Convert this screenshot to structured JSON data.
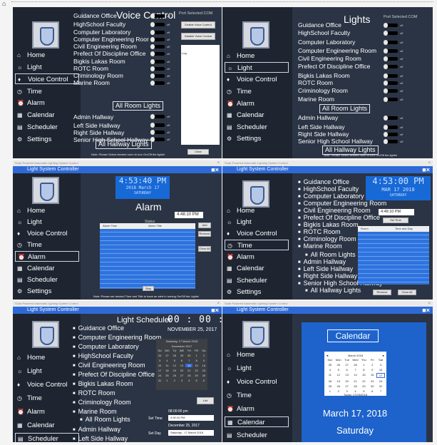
{
  "nav": {
    "home": "Home",
    "light": "Light",
    "voice": "Voice Control",
    "time": "Time",
    "alarm": "Alarm",
    "calendar": "Calendar",
    "scheduler": "Scheduler",
    "settings": "Settings"
  },
  "icons": [
    "home-icon",
    "bulb-icon",
    "mic-icon",
    "clock-icon",
    "alarm-icon",
    "calendar-icon",
    "scheduler-icon",
    "settings-icon"
  ],
  "accent": "#2e6ad6",
  "window_title": "Light System Controller",
  "outer_title": "Solar Powered Automatic Lighting System Control",
  "off": "off",
  "voice": {
    "title": "Voice Control",
    "port": "Port Selected COM",
    "enable": "Enable Voice Control",
    "disable": "Disable Voice Control",
    "log": "Log",
    "clear": "Clear",
    "rooms": [
      "Guidance Office",
      "HighSchool Faculty",
      "Computer Laboratory",
      "Computer Engineering Roor",
      "Civil Engineering Room",
      "Prefect Of Discipline Office",
      "Bigkis Lakas Room",
      "ROTC Room",
      "Criminology Room",
      "Marine Room"
    ],
    "all_rooms": "All Room Lights",
    "halls": [
      "Admin Hallway",
      "Left Side Hallway",
      "Right Side Hallway",
      "Senior High School Hallway"
    ],
    "all_halls": "All Hallway Lights",
    "note": "Note: Please Select desired room to turn On/Off the lights!"
  },
  "lights": {
    "title": "Lights",
    "port": "Port Selected COM",
    "rooms": [
      "Guidance Office",
      "HighSchool Faculty",
      "Computer Laboratory",
      "Computer Engineering Room",
      "Civil Engineering Room",
      "Prefect Of Discipline Office",
      "Bigkis Lakas Room",
      "ROTC Room",
      "Criminology Room",
      "Marine Room"
    ],
    "all_rooms": "All Room Lights",
    "halls": [
      "Admin Hallway",
      "Left Side Hallway",
      "Right Side Hallway",
      "Senior High School Hallway"
    ],
    "all_halls": "All Hallway Lights",
    "note": "Note: Please Select desired room to turn On/Off the lights!"
  },
  "alarm": {
    "clock": "4:53:40 PM",
    "date": "2018 March 17",
    "day": "SATURDAY",
    "title": "Alarm",
    "time_value": "4:48:10 PM",
    "status": "Status",
    "col1": "Alarm Time",
    "col2": "Alarm Title",
    "add": "Add",
    "remove": "Remove",
    "clear_all": "Clear All",
    "stop": "Stop",
    "note": "Note: Please set desired Time and Title to have an alert in turning On/Off the Lights!"
  },
  "time_panel": {
    "clock": "4:53:00 PM",
    "date": "MAR 17 2018",
    "day": "SATURDAY",
    "time_value": "4:48:10 PM",
    "set_time": "Set Time",
    "col1": "Room",
    "col2": "Time and Day",
    "remove": "Remove",
    "clear_all": "Clear All",
    "rooms": [
      "Guidance Office",
      "HighSchool Faculty",
      "Computer Laboratory",
      "Computer Engineering Room",
      "Civil Engineering Room",
      "Prefect Of Discipline Office",
      "Bigkis Lakas Room",
      "ROTC Room",
      "Criminology Room",
      "Marine Room"
    ],
    "all_rooms": "All Room Lights",
    "halls": [
      "Admin Hallway",
      "Left Side Hallway",
      "Right Side Hallway",
      "Senior High School Hallway"
    ],
    "all_halls": "All Hallway Lights"
  },
  "scheduler": {
    "title": "Light Scheduler",
    "clock": "00 : 00 : 00",
    "date": "NOVEMBER 25, 2017",
    "rooms": [
      "Guidance Office",
      "Computer Engineering Room",
      "Computer Laboratory",
      "HighSchool Faculty",
      "Civil Engineering Room",
      "Prefect Of Discipline Office",
      "Bigkis Lakas Room",
      "ROTC Room",
      "Criminology Room",
      "Marine Room"
    ],
    "all_rooms": "All Room Lights",
    "halls": [
      "Admin Hallway",
      "Left Side Hallway"
    ],
    "cal_header": "Saturday, 17 March 2018",
    "cal_month": "December 2017",
    "cal_days": [
      "SU",
      "MO",
      "TU",
      "WE",
      "TH",
      "FR",
      "SA"
    ],
    "cal_dates": [
      "26",
      "27",
      "28",
      "29",
      "30",
      "1",
      "2",
      "3",
      "4",
      "5",
      "6",
      "7",
      "8",
      "9",
      "10",
      "11",
      "12",
      "13",
      "14",
      "15",
      "16",
      "17",
      "18",
      "19",
      "20",
      "21",
      "22",
      "23",
      "24",
      "25",
      "26",
      "27",
      "28",
      "29",
      "30",
      "31",
      "1",
      "2",
      "3",
      "4",
      "5",
      "6"
    ],
    "selected": "14",
    "list": "List",
    "time_shown": "08:00:00 pm",
    "set_time": "Set Time",
    "set_time_value": "4:30:10 PM",
    "date_shown": "December 25, 2017",
    "set_day": "Set Day",
    "set_day_value": "Saturday , 17   March   2018"
  },
  "calendar": {
    "title": "Calendar",
    "month": "March 2018",
    "days": [
      "Sun",
      "Mon",
      "Tue",
      "Wed",
      "Thu",
      "Fri",
      "Sat"
    ],
    "dates": [
      "25",
      "26",
      "27",
      "28",
      "1",
      "2",
      "3",
      "4",
      "5",
      "6",
      "7",
      "8",
      "9",
      "10",
      "11",
      "12",
      "13",
      "14",
      "15",
      "16",
      "17",
      "18",
      "19",
      "20",
      "21",
      "22",
      "23",
      "24",
      "25",
      "26",
      "27",
      "28",
      "29",
      "30",
      "31",
      "1",
      "2",
      "3",
      "4",
      "5",
      "6",
      "7"
    ],
    "today": "Today: 17/03/2018",
    "date": "March 17, 2018",
    "day": "Saturday"
  }
}
